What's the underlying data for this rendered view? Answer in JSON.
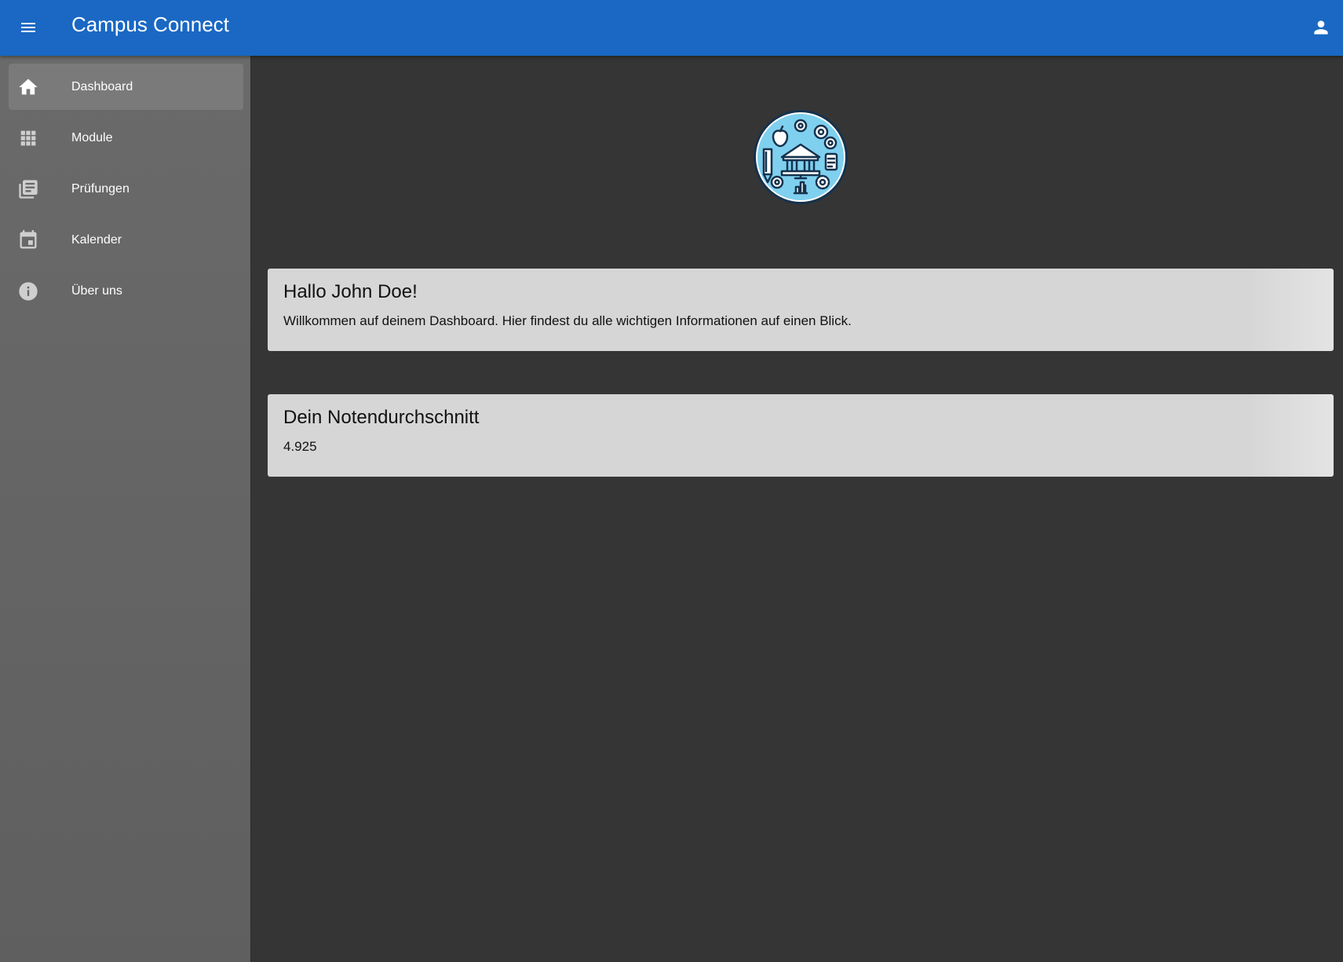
{
  "header": {
    "title": "Campus Connect",
    "menu_icon": "hamburger-menu-icon",
    "account_icon": "person-icon",
    "color": "#1a68c3"
  },
  "sidebar": {
    "items": [
      {
        "label": "Dashboard",
        "icon": "home-icon",
        "active": true
      },
      {
        "label": "Module",
        "icon": "grid-icon",
        "active": false
      },
      {
        "label": "Prüfungen",
        "icon": "library-books-icon",
        "active": false
      },
      {
        "label": "Kalender",
        "icon": "calendar-icon",
        "active": false
      },
      {
        "label": "Über uns",
        "icon": "info-icon",
        "active": false
      }
    ]
  },
  "main": {
    "logo_icon": "campus-education-logo",
    "welcome_card": {
      "title": "Hallo John Doe!",
      "text": "Willkommen auf deinem Dashboard. Hier findest du alle wichtigen Informationen auf einen Blick."
    },
    "grade_card": {
      "title": "Dein Notendurchschnitt",
      "value": "4.925"
    }
  }
}
